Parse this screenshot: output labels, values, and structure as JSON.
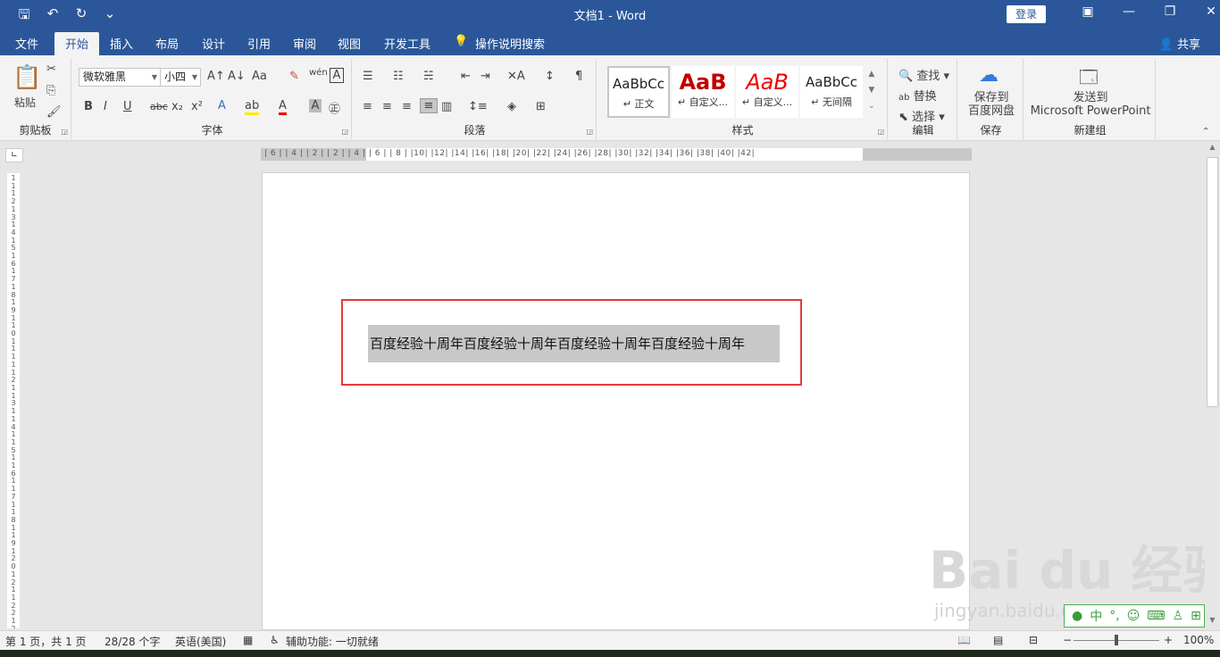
{
  "titlebar": {
    "title": "文档1  -  Word",
    "login": "登录",
    "qat_icons": [
      "save-icon",
      "undo-icon",
      "redo-icon",
      "customize-icon"
    ],
    "window_buttons": [
      "restore-ribbon-icon",
      "minimize-icon",
      "maximize-icon",
      "close-icon"
    ]
  },
  "tabs": [
    "文件",
    "开始",
    "插入",
    "布局",
    "设计",
    "引用",
    "审阅",
    "视图",
    "开发工具",
    "操作说明搜索"
  ],
  "active_tab": "开始",
  "share": "共享",
  "ribbon": {
    "clipboard": {
      "paste": "粘贴",
      "label": "剪贴板"
    },
    "font": {
      "name": "微软雅黑",
      "size": "小四",
      "label": "字体"
    },
    "paragraph": {
      "label": "段落"
    },
    "styles": {
      "label": "样式",
      "items": [
        {
          "sample": "AaBbCc",
          "name": "↵ 正文"
        },
        {
          "sample": "AaB",
          "name": "↵ 自定义..."
        },
        {
          "sample": "AaB",
          "name": "↵ 自定义..."
        },
        {
          "sample": "AaBbCc",
          "name": "↵ 无间隔"
        }
      ]
    },
    "editing": {
      "find": "查找",
      "replace": "替换",
      "select": "选择",
      "label": "编辑"
    },
    "save": {
      "line1": "保存到",
      "line2": "百度网盘",
      "label": "保存"
    },
    "new_group": {
      "line1": "发送到",
      "line2": "Microsoft PowerPoint",
      "label": "新建组"
    }
  },
  "ruler": {
    "ticks": "| 6 |  | 4 |  | 2 |     | 2 |  | 4 |  | 6 |  | 8 |  |10|  |12|  |14|  |16|  |18|  |20|  |22|  |24|  |26|  |28|  |30|  |32|  |34|  |36|  |38|  |40|  |42|",
    "vticks": "1 1 1 2 1 3 1 4 1 5 1 6 1 7 1 8 1 9 1 10 1 11 1 12 1 13 1 14 1 15 1 16 1 17 1 18 1 19 1 20 1 21 1 22 1 23 1 24"
  },
  "document": {
    "text": "百度经验十周年百度经验十周年百度经验十周年百度经验十周年"
  },
  "status": {
    "page": "第 1 页，共 1 页",
    "words": "28/28 个字",
    "language": "英语(美国)",
    "accessibility": "辅助功能: 一切就绪",
    "zoom": "100%"
  },
  "watermark": {
    "brand": "Bai du 经验",
    "url": "jingyan.baidu.com"
  },
  "ime": {
    "mode": "中"
  }
}
